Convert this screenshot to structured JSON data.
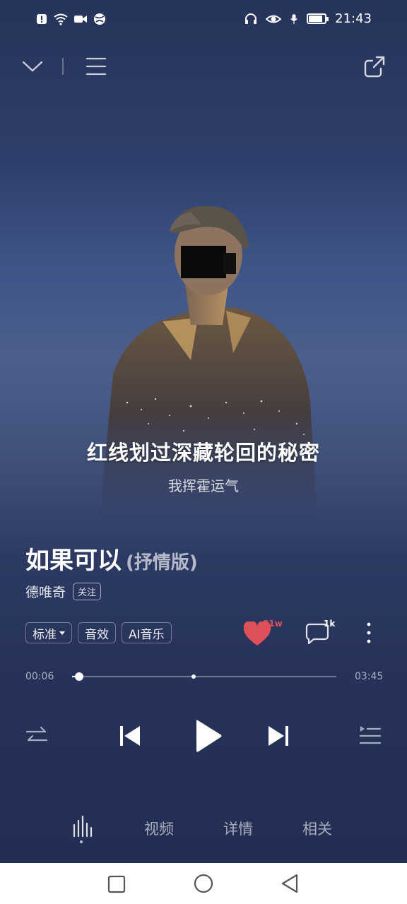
{
  "status_bar": {
    "time": "21:43",
    "left_icons": [
      "alert-icon",
      "wifi-icon",
      "video-call-icon",
      "globe-icon"
    ],
    "right_icons": [
      "headphones-icon",
      "eye-icon",
      "mic-icon",
      "battery-icon"
    ],
    "battery_level": 0.8
  },
  "top_bar": {
    "icons": [
      "chevron-down-icon",
      "menu-icon",
      "share-icon"
    ]
  },
  "lyrics": {
    "current": "红线划过深藏轮回的秘密",
    "next": "我挥霍运气"
  },
  "song": {
    "title": "如果可以",
    "version": "(抒情版)",
    "artist": "德唯奇",
    "follow_label": "关注"
  },
  "chips": {
    "quality": "标准",
    "effects": "音效",
    "ai_music": "AI音乐"
  },
  "actions": {
    "like_count": "31w",
    "comment_count": "1k",
    "like_color": "#e0505a"
  },
  "progress": {
    "elapsed": "00:06",
    "duration": "03:45",
    "fraction": 0.027,
    "marker_fraction": 0.46
  },
  "tabs": {
    "items": [
      "视频",
      "详情",
      "相关"
    ]
  }
}
